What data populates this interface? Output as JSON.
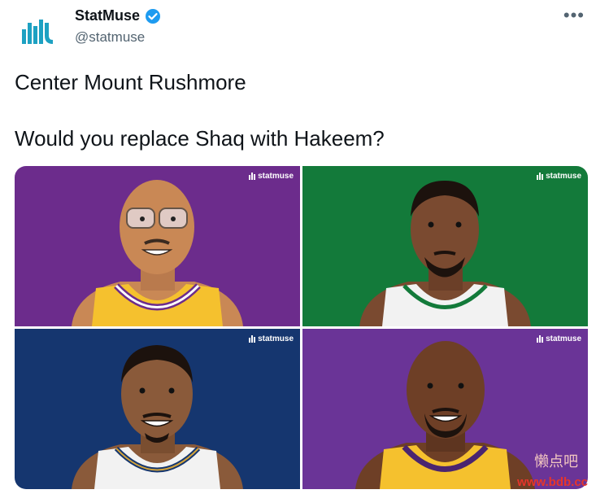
{
  "tweet": {
    "author_name": "StatMuse",
    "handle": "@statmuse",
    "line1": "Center Mount Rushmore",
    "line2": "Would you replace Shaq with Hakeem?"
  },
  "icons": {
    "avatar": "statmuse-logo",
    "verified": "verified-badge-icon",
    "more": "more-options-icon"
  },
  "colors": {
    "verified": "#1d9bf0",
    "logo": "#1da1c2",
    "panel_tl": "#6c2c8c",
    "panel_tr": "#137a3a",
    "panel_bl": "#15366f",
    "panel_br": "#6a3497"
  },
  "panels": [
    {
      "watermark": "statmuse",
      "jersey": "Lakers gold"
    },
    {
      "watermark": "statmuse",
      "jersey": "Celtics white"
    },
    {
      "watermark": "statmuse",
      "jersey": "Rockets white"
    },
    {
      "watermark": "statmuse",
      "jersey": "Lakers gold"
    }
  ],
  "site_watermark": "www.bdb.cc",
  "site_watermark_cn": "懒点吧"
}
